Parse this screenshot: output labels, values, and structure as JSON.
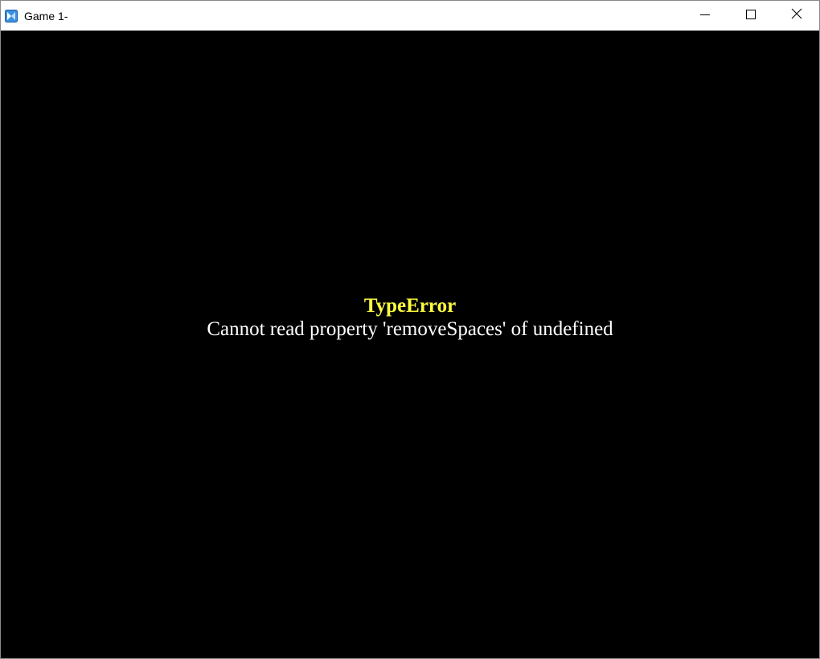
{
  "window": {
    "title": "Game 1-",
    "icon": "rpg-maker-icon",
    "controls": {
      "minimize": "minimize-icon",
      "maximize": "maximize-icon",
      "close": "close-icon"
    }
  },
  "error": {
    "name": "TypeError",
    "message": "Cannot read property 'removeSpaces' of undefined"
  },
  "colors": {
    "titlebar_bg": "#ffffff",
    "game_bg": "#000000",
    "error_name": "#ffff40",
    "error_message": "#ffffff"
  }
}
